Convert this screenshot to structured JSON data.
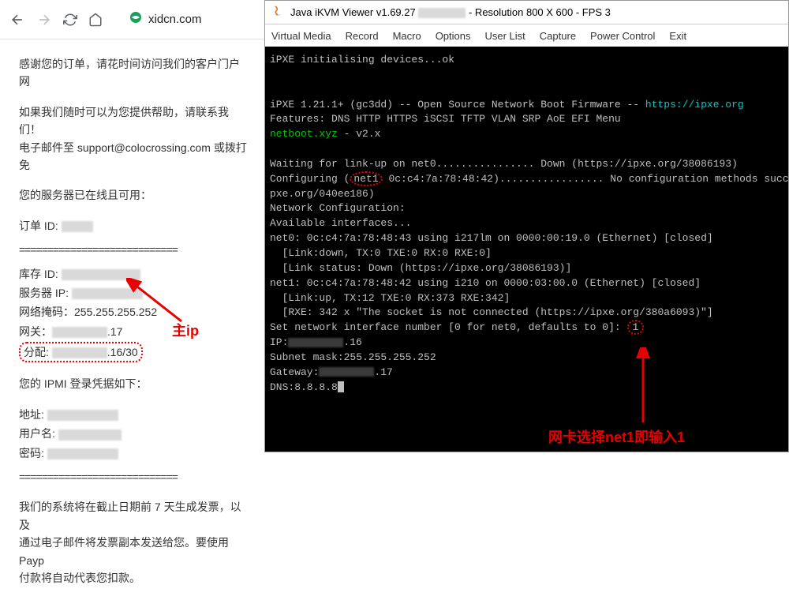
{
  "browser": {
    "url": "xidcn.com"
  },
  "email_content": {
    "greeting": "感谢您的订单，请花时间访问我们的客户门户网",
    "help_line1": "如果我们随时可以为您提供帮助，请联系我们！",
    "help_line2_prefix": "电子邮件至 ",
    "support_email": "support@colocrossing.com",
    "help_line2_suffix": " 或拨打免",
    "server_ready": "您的服务器已在线且可用：",
    "order_label": "订单 ID:",
    "divider": "============================",
    "inventory_label": "库存 ID:",
    "server_ip_label": "服务器 IP:",
    "netmask_label": "网络掩码：",
    "netmask_value": "255.255.255.252",
    "gateway_label": "网关：",
    "gateway_suffix": ".17",
    "allocation_label": "分配:",
    "allocation_suffix": ".16/30",
    "ipmi_header": "您的 IPMI 登录凭据如下：",
    "address_label": "地址:",
    "username_label": "用户名:",
    "password_label": "密码:",
    "billing_line1": "我们的系统将在截止日期前 7 天生成发票，以及",
    "billing_line2": "通过电子邮件将发票副本发送给您。要使用 Payp",
    "billing_line3": "付款将自动代表您扣款。"
  },
  "kvm": {
    "title_prefix": "Java iKVM Viewer v1.69.27",
    "title_suffix": "- Resolution 800 X 600 - FPS 3",
    "menu": {
      "virtual_media": "Virtual Media",
      "record": "Record",
      "macro": "Macro",
      "options": "Options",
      "user_list": "User List",
      "capture": "Capture",
      "power_control": "Power Control",
      "exit": "Exit"
    },
    "console": {
      "line1": "iPXE initialising devices...ok",
      "line2_a": "iPXE 1.21.1+ (gc3dd) -- Open Source Network Boot Firmware -- ",
      "line2_link": "https://ipxe.org",
      "line3": "Features: DNS HTTP HTTPS iSCSI TFTP VLAN SRP AoE EFI Menu",
      "line4_a": "netboot.xyz",
      "line4_b": " - v2.x",
      "line6": "Waiting for link-up on net0................ Down (https://ipxe.org/38086193)",
      "line7_a": "Configuring (",
      "line7_b": "net1",
      "line7_c": " 0c:c4:7a:78:48:42)................. No configuration methods succ",
      "line7_d": "pxe.org/040ee186)",
      "line8": "Network Configuration:",
      "line9": "Available interfaces...",
      "line10": "net0: 0c:c4:7a:78:48:43 using i217lm on 0000:00:19.0 (Ethernet) [closed]",
      "line11": "  [Link:down, TX:0 TXE:0 RX:0 RXE:0]",
      "line12": "  [Link status: Down (https://ipxe.org/38086193)]",
      "line13": "net1: 0c:c4:7a:78:48:42 using i210 on 0000:03:00.0 (Ethernet) [closed]",
      "line14": "  [Link:up, TX:12 TXE:0 RX:373 RXE:342]",
      "line15": "  [RXE: 342 x \"The socket is not connected (https://ipxe.org/380a6093)\"]",
      "line16_a": "Set network interface number [0 for net0, defaults to 0]:",
      "line16_b": "1",
      "line17_a": "IP:",
      "line17_b": ".16",
      "line18": "Subnet mask:255.255.255.252",
      "line19_a": "Gateway:",
      "line19_b": ".17",
      "line20": "DNS:8.8.8.8"
    }
  },
  "annotations": {
    "main_ip": "主ip",
    "netcard_hint": "网卡选择net1即输入1"
  }
}
